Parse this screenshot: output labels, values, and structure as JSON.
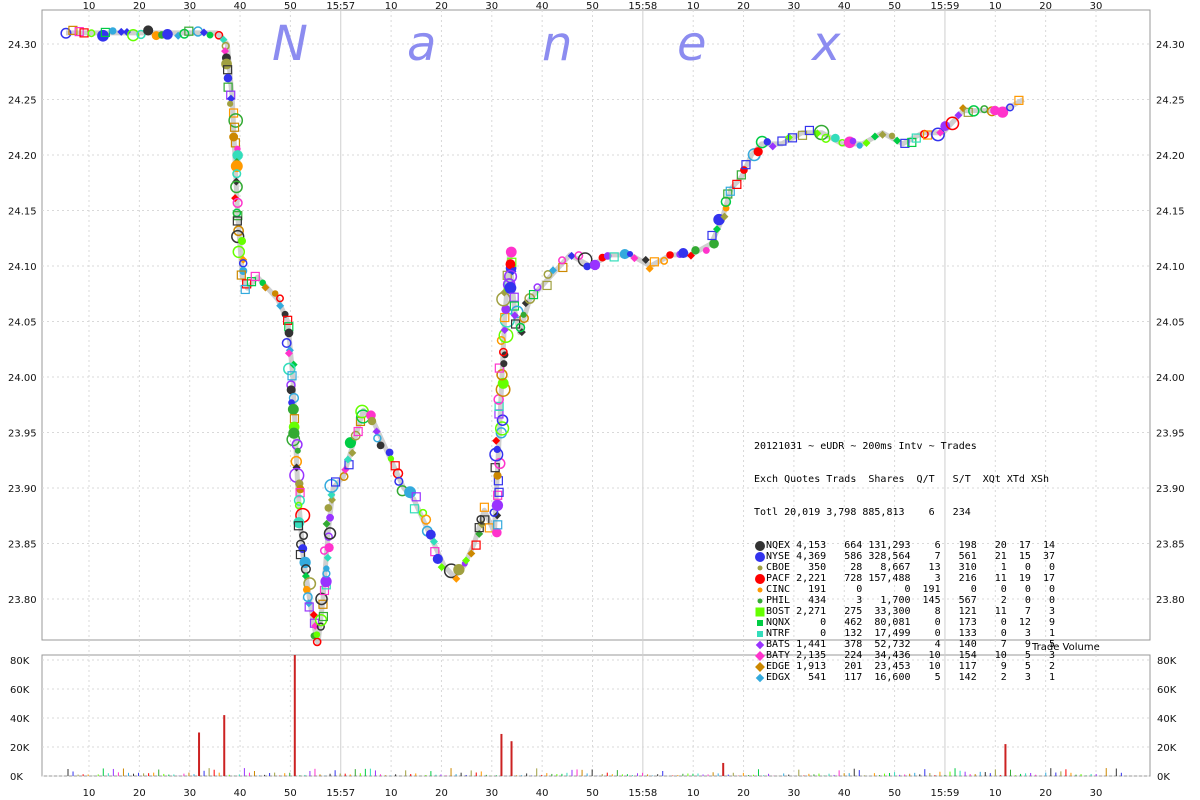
{
  "chart_data": [
    {
      "type": "scatter",
      "title": "20121031 ~ eUDR ~ 200ms Intv ~ Trades",
      "watermark": [
        "N",
        "a",
        "n",
        "e",
        "x"
      ],
      "x_ticks": [
        "10",
        "20",
        "30",
        "40",
        "50",
        "15:57",
        "10",
        "20",
        "30",
        "40",
        "50",
        "15:58",
        "10",
        "20",
        "30",
        "40",
        "50",
        "15:59",
        "10",
        "20",
        "30"
      ],
      "y_ticks": [
        "24.30",
        "24.25",
        "24.20",
        "24.15",
        "24.10",
        "24.05",
        "24.00",
        "23.95",
        "23.90",
        "23.85",
        "23.80"
      ],
      "ylim": [
        23.75,
        24.32
      ],
      "grid": true,
      "price_path": [
        [
          0,
          24.31
        ],
        [
          30,
          24.31
        ],
        [
          32,
          24.3
        ],
        [
          33,
          24.25
        ],
        [
          34,
          24.15
        ],
        [
          35,
          24.09
        ],
        [
          36,
          24.08
        ],
        [
          38,
          24.09
        ],
        [
          40,
          24.08
        ],
        [
          42,
          24.07
        ],
        [
          44,
          24.05
        ],
        [
          45,
          24.0
        ],
        [
          46,
          23.9
        ],
        [
          47,
          23.84
        ],
        [
          48,
          23.81
        ],
        [
          49,
          23.78
        ],
        [
          50,
          23.76
        ],
        [
          51,
          23.8
        ],
        [
          52,
          23.86
        ],
        [
          53,
          23.9
        ],
        [
          55,
          23.91
        ],
        [
          57,
          23.94
        ],
        [
          59,
          23.97
        ],
        [
          61,
          23.96
        ],
        [
          63,
          23.94
        ],
        [
          65,
          23.92
        ],
        [
          67,
          23.9
        ],
        [
          69,
          23.89
        ],
        [
          71,
          23.87
        ],
        [
          73,
          23.85
        ],
        [
          75,
          23.83
        ],
        [
          77,
          23.82
        ],
        [
          79,
          23.83
        ],
        [
          81,
          23.85
        ],
        [
          83,
          23.88
        ],
        [
          85,
          23.86
        ],
        [
          86,
          23.95
        ],
        [
          87,
          24.05
        ],
        [
          88,
          24.11
        ],
        [
          89,
          24.06
        ],
        [
          90,
          24.04
        ],
        [
          92,
          24.07
        ],
        [
          94,
          24.08
        ],
        [
          96,
          24.09
        ],
        [
          98,
          24.1
        ],
        [
          100,
          24.11
        ],
        [
          104,
          24.1
        ],
        [
          108,
          24.11
        ],
        [
          112,
          24.11
        ],
        [
          116,
          24.1
        ],
        [
          120,
          24.11
        ],
        [
          124,
          24.11
        ],
        [
          128,
          24.12
        ],
        [
          130,
          24.14
        ],
        [
          132,
          24.17
        ],
        [
          134,
          24.18
        ],
        [
          136,
          24.2
        ],
        [
          138,
          24.21
        ],
        [
          142,
          24.21
        ],
        [
          146,
          24.22
        ],
        [
          150,
          24.22
        ],
        [
          154,
          24.21
        ],
        [
          158,
          24.21
        ],
        [
          162,
          24.22
        ],
        [
          166,
          24.21
        ],
        [
          170,
          24.22
        ],
        [
          174,
          24.22
        ],
        [
          178,
          24.24
        ],
        [
          182,
          24.24
        ],
        [
          186,
          24.24
        ],
        [
          190,
          24.25
        ]
      ]
    },
    {
      "type": "bar",
      "title": "Trade Volume",
      "y_ticks": [
        "80K",
        "60K",
        "40K",
        "20K",
        "0K"
      ],
      "ylim": [
        0,
        80000
      ],
      "notable_bars": [
        {
          "x": 26,
          "value": 30000
        },
        {
          "x": 31,
          "value": 42000
        },
        {
          "x": 45,
          "value": 85000
        },
        {
          "x": 86,
          "value": 29000
        },
        {
          "x": 88,
          "value": 24000
        },
        {
          "x": 130,
          "value": 9000
        },
        {
          "x": 186,
          "value": 22000
        }
      ]
    }
  ],
  "stats_table": {
    "title": "20121031 ~ eUDR ~ 200ms Intv ~ Trades",
    "header": "Exch Quotes Trads  Shares  Q/T   S/T  XQt XTd XSh",
    "total": "Totl 20,019 3,798 885,813    6   234",
    "rows": [
      {
        "text": "NQEX 4,153   664 131,293    6   198   20  17  14",
        "color": "#333333",
        "shape": "octagon"
      },
      {
        "text": "NYSE 4,369   586 328,564    7   561   21  15  37",
        "color": "#3333ee",
        "shape": "circle-big"
      },
      {
        "text": "CBOE   350    28   8,667   13   310    1   0   0",
        "color": "#a0a040",
        "shape": "circle-small"
      },
      {
        "text": "PACF 2,221   728 157,488    3   216   11  19  17",
        "color": "#ff0000",
        "shape": "circle-red"
      },
      {
        "text": "CINC   191     0       0  191     0    0   0   0",
        "color": "#ff9900",
        "shape": "dot"
      },
      {
        "text": "PHIL   434     3   1,700  145   567    2   0   0",
        "color": "#33aa33",
        "shape": "dot"
      },
      {
        "text": "BOST 2,271   275  33,300    8   121   11   7   3",
        "color": "#66ff00",
        "shape": "square"
      },
      {
        "text": "NQNX     0   462  80,081    0   173    0  12   9",
        "color": "#00cc44",
        "shape": "square-small"
      },
      {
        "text": "NTRF     0   132  17,499    0   133    0   3   1",
        "color": "#33ddbb",
        "shape": "square-small"
      },
      {
        "text": "BATS 1,441   378  52,732    4   140    7   9   5",
        "color": "#9933ff",
        "shape": "diamond"
      },
      {
        "text": "BATY 2,135   224  34,436   10   154   10   5   3",
        "color": "#ff33cc",
        "shape": "diamond-big"
      },
      {
        "text": "EDGE 1,913   201  23,453   10   117    9   5   2",
        "color": "#cc8800",
        "shape": "diamond-big"
      },
      {
        "text": "EDGX   541   117  16,600    5   142    2   3   1",
        "color": "#33aadd",
        "shape": "diamond"
      }
    ]
  },
  "volume_label": "Trade Volume"
}
